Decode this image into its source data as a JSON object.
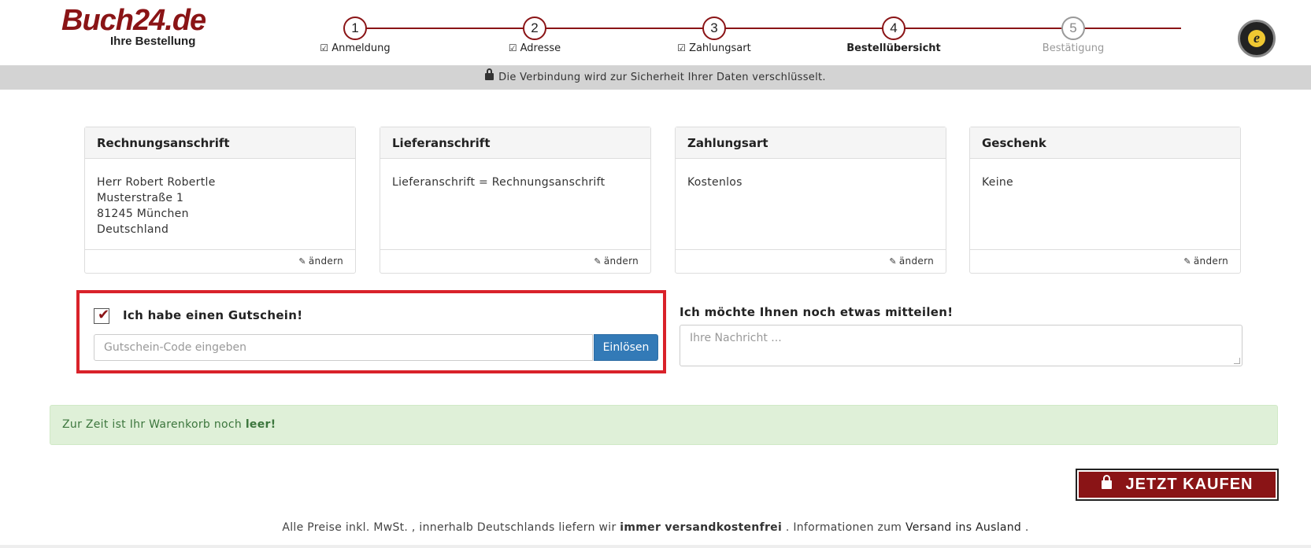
{
  "logo": {
    "main": "Buch24.de",
    "sub": "Ihre Bestellung"
  },
  "steps": [
    {
      "num": "1",
      "label": "Anmeldung",
      "done": true
    },
    {
      "num": "2",
      "label": "Adresse",
      "done": true
    },
    {
      "num": "3",
      "label": "Zahlungsart",
      "done": true
    },
    {
      "num": "4",
      "label": "Bestellübersicht",
      "current": true
    },
    {
      "num": "5",
      "label": "Bestätigung",
      "pending": true
    }
  ],
  "secure_text": "Die Verbindung wird zur Sicherheit Ihrer Daten verschlüsselt.",
  "cards": [
    {
      "title": "Rechnungsanschrift",
      "lines": [
        "Herr Robert Robertle",
        "Musterstraße 1",
        "81245 München",
        "Deutschland"
      ],
      "edit": "ändern"
    },
    {
      "title": "Lieferanschrift",
      "lines": [
        "Lieferanschrift = Rechnungsanschrift"
      ],
      "edit": "ändern"
    },
    {
      "title": "Zahlungsart",
      "lines": [
        "Kostenlos"
      ],
      "edit": "ändern"
    },
    {
      "title": "Geschenk",
      "lines": [
        "Keine"
      ],
      "edit": "ändern"
    }
  ],
  "coupon": {
    "label": "Ich habe einen Gutschein!",
    "placeholder": "Gutschein-Code eingeben",
    "button": "Einlösen",
    "checked": true
  },
  "message": {
    "label": "Ich möchte Ihnen noch etwas mitteilen!",
    "placeholder": "Ihre Nachricht ..."
  },
  "alert": {
    "text": "Zur Zeit ist Ihr Warenkorb noch ",
    "bold": "leer!"
  },
  "buy_button": "JETZT KAUFEN",
  "footer": {
    "part1": "Alle Preise inkl. MwSt. , innerhalb Deutschlands liefern wir ",
    "bold": "immer versandkostenfrei",
    "part2": " . Informationen zum ",
    "link": "Versand ins Ausland",
    "part3": " ."
  },
  "colors": {
    "brand": "#8a1416",
    "highlight": "#d9222a",
    "primary": "#337ab7",
    "alert_bg": "#dff0d8"
  },
  "icons": {
    "check": "check-square-icon",
    "lock": "lock-icon",
    "edit": "pencil-icon",
    "trusted": "trusted-shops-icon"
  }
}
